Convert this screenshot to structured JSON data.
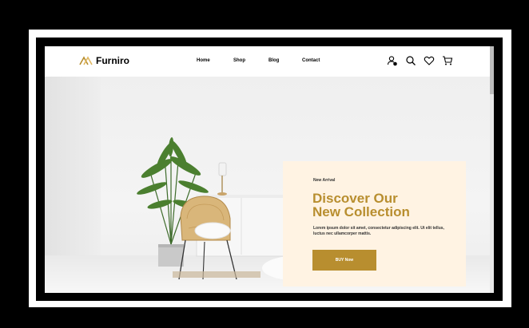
{
  "brand": {
    "name": "Furniro",
    "accent": "#b88e2f"
  },
  "nav": {
    "items": [
      "Home",
      "Shop",
      "Blog",
      "Contact"
    ]
  },
  "header_icons": [
    "account-alert-icon",
    "search-icon",
    "heart-icon",
    "cart-icon"
  ],
  "hero": {
    "eyebrow": "New Arrival",
    "title_line1": "Discover Our",
    "title_line2": "New Collection",
    "description": "Lorem ipsum dolor sit amet, consectetur adipiscing elit. Ut elit tellus, luctus nec ullamcorper mattis.",
    "button_label": "BUY Now",
    "card_bg": "#fff3e3"
  }
}
